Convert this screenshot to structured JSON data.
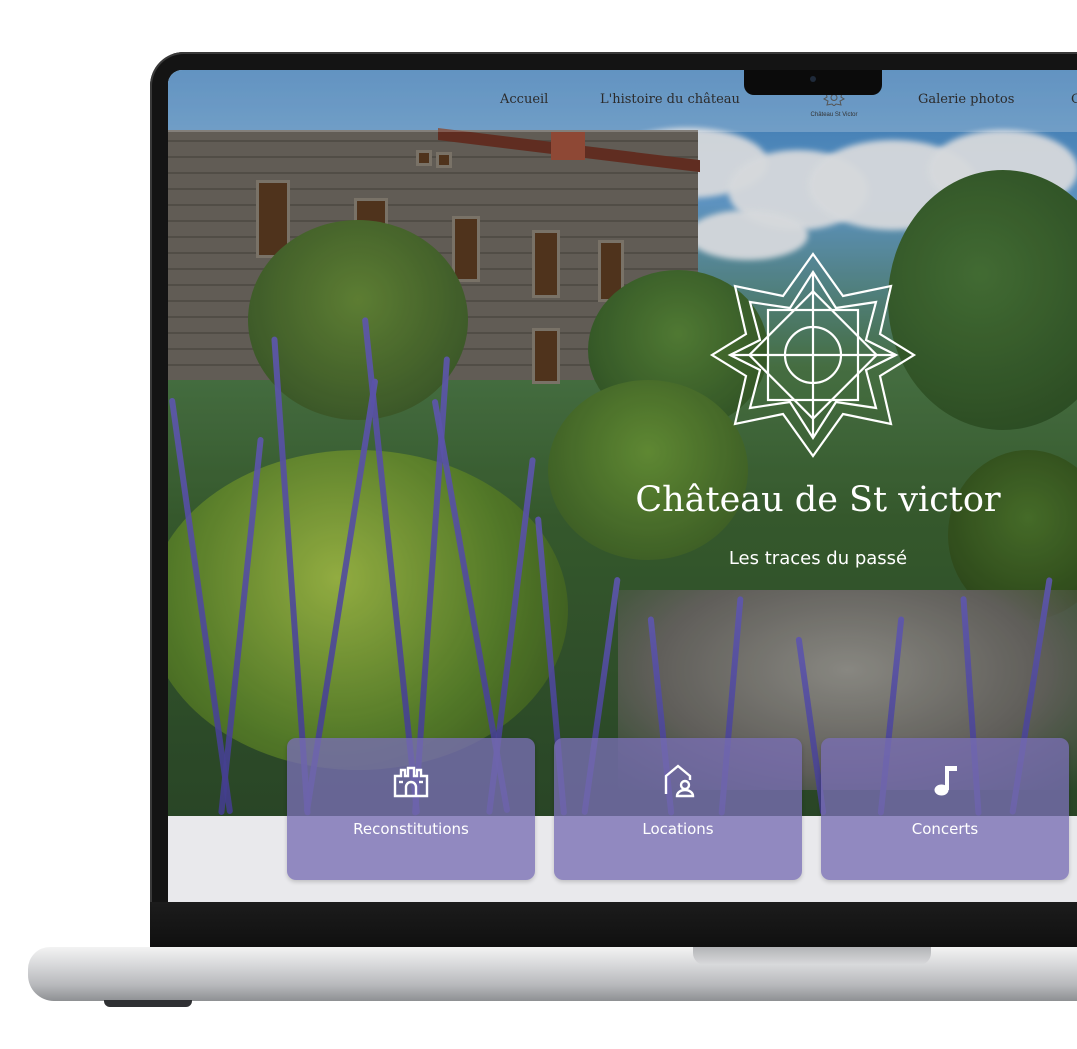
{
  "nav": {
    "items": [
      {
        "label": "Accueil"
      },
      {
        "label": "L'histoire du château"
      },
      {
        "label": "Galerie photos"
      },
      {
        "label": "C"
      }
    ],
    "logo_text": "Château St Victor"
  },
  "hero": {
    "title": "Château de St victor",
    "subtitle": "Les traces du passé"
  },
  "cards": [
    {
      "label": "Reconstitutions",
      "icon": "castle-icon"
    },
    {
      "label": "Locations",
      "icon": "home-person-icon"
    },
    {
      "label": "Concerts",
      "icon": "music-note-icon"
    }
  ],
  "colors": {
    "card_background": "#786eb4",
    "text": "#ffffff",
    "nav_text": "#2b2b2b"
  }
}
